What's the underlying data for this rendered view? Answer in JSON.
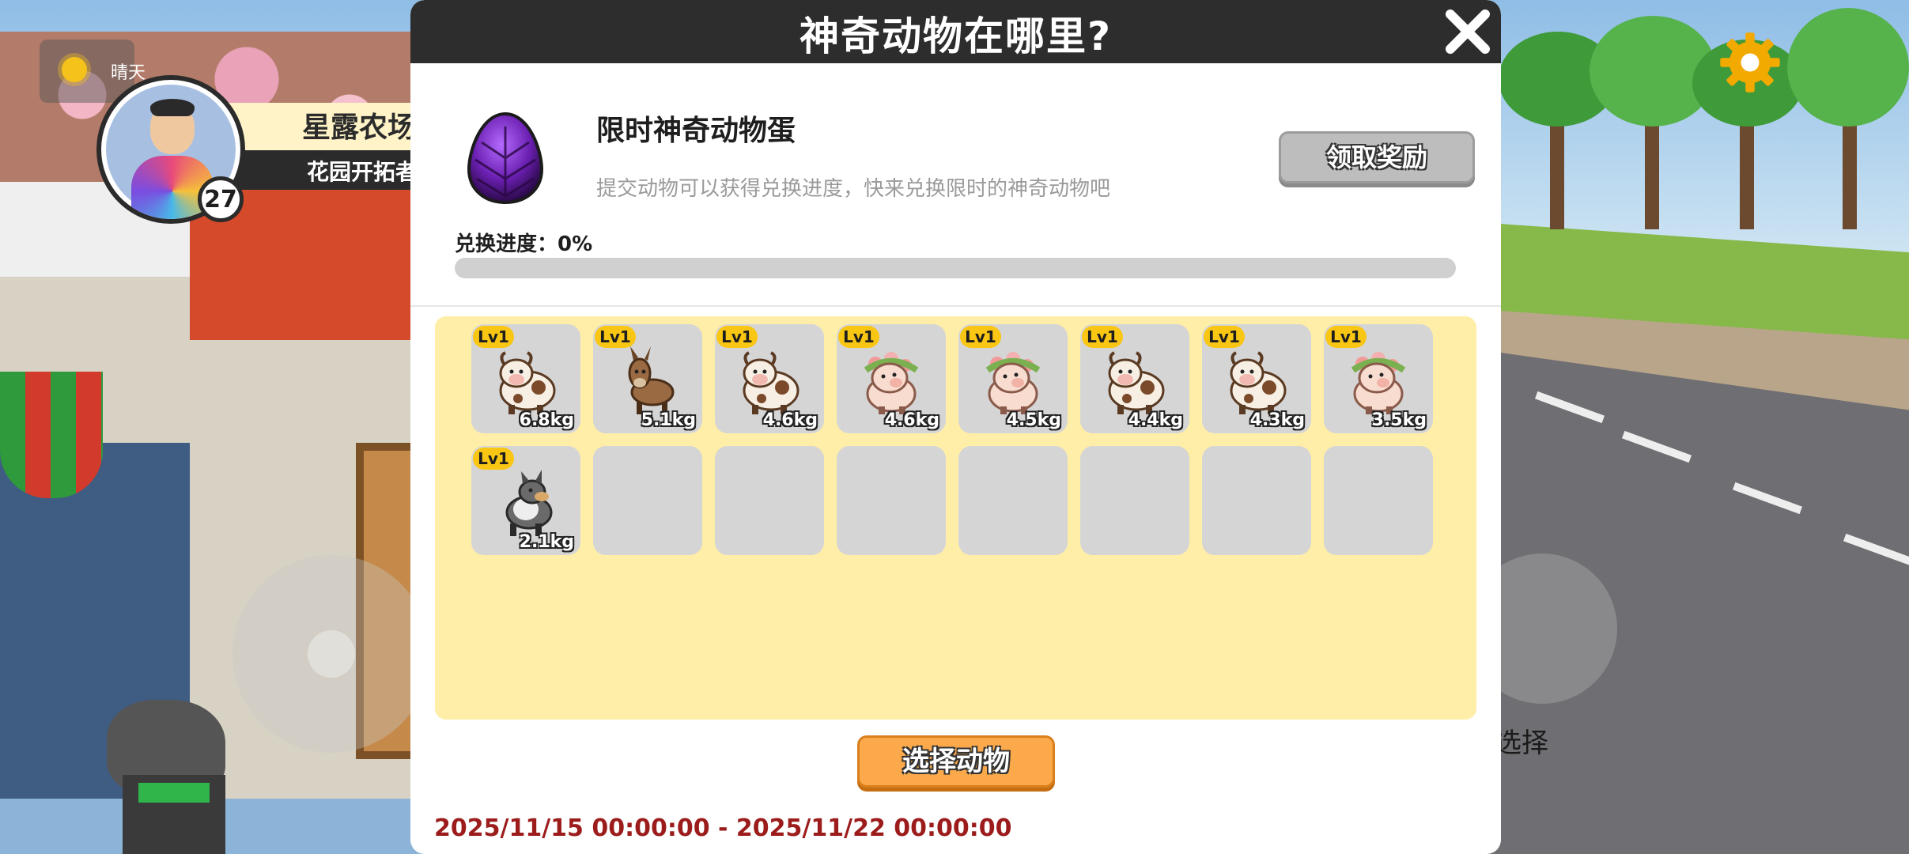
{
  "hud": {
    "weather_label": "晴天",
    "farm_name": "星露农场",
    "farm_subtitle": "花园开拓者",
    "player_level": "27",
    "action_label": "选择"
  },
  "modal": {
    "title": "神奇动物在哪里?",
    "reward_title": "限时神奇动物蛋",
    "reward_desc": "提交动物可以获得兑换进度，快来兑换限时的神奇动物吧",
    "claim_label": "领取奖励",
    "progress_label": "兑换进度：0%",
    "progress_value": 0,
    "select_label": "选择动物",
    "event_time": "2025/11/15 00:00:00 - 2025/11/22 00:00:00"
  },
  "animals": [
    {
      "kind": "cow",
      "level": "Lv1",
      "weight": "6.8kg"
    },
    {
      "kind": "donkey",
      "level": "Lv1",
      "weight": "5.1kg"
    },
    {
      "kind": "cow",
      "level": "Lv1",
      "weight": "4.6kg"
    },
    {
      "kind": "pig",
      "level": "Lv1",
      "weight": "4.6kg"
    },
    {
      "kind": "pig",
      "level": "Lv1",
      "weight": "4.5kg"
    },
    {
      "kind": "cow",
      "level": "Lv1",
      "weight": "4.4kg"
    },
    {
      "kind": "cow",
      "level": "Lv1",
      "weight": "4.3kg"
    },
    {
      "kind": "pig",
      "level": "Lv1",
      "weight": "3.5kg"
    },
    {
      "kind": "wolf",
      "level": "Lv1",
      "weight": "2.1kg"
    }
  ],
  "empty_slots": 7,
  "colors": {
    "header": "#2d2d2d",
    "panel": "#ffeea8",
    "accent_orange": "#fba94b",
    "level_badge": "#f9c613",
    "event_time": "#9c1c1c"
  }
}
